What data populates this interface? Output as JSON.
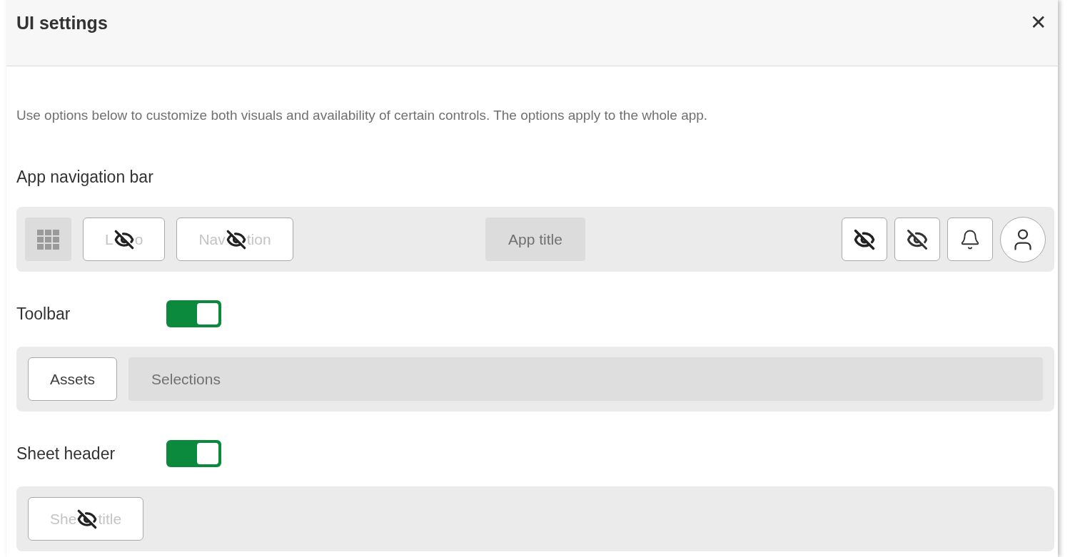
{
  "dialog": {
    "title": "UI settings",
    "close": "✕"
  },
  "description": "Use options below to customize both visuals and availability of certain controls. The options apply to the whole app.",
  "sections": [
    {
      "title": "App navigation bar",
      "items": [
        {
          "kind": "grid"
        },
        {
          "kind": "button",
          "parts": [
            "L",
            "o"
          ],
          "hidden": true
        },
        {
          "kind": "button",
          "parts": [
            "Nav",
            "tion"
          ],
          "hidden": true
        },
        {
          "kind": "title",
          "label": "App title"
        },
        {
          "kind": "eye",
          "hidden": true
        },
        {
          "kind": "eye",
          "hidden": true
        },
        {
          "kind": "bell"
        },
        {
          "kind": "avatar"
        }
      ]
    },
    {
      "title": "Toolbar",
      "toggle": {
        "on": true
      },
      "items": [
        {
          "kind": "button",
          "parts": [
            "Assets"
          ],
          "hidden": false
        },
        {
          "kind": "bar",
          "label": "Selections"
        }
      ]
    },
    {
      "title": "Sheet header",
      "toggle": {
        "on": true
      },
      "items": [
        {
          "kind": "button",
          "parts": [
            "She",
            "title"
          ],
          "hidden": true
        }
      ]
    }
  ]
}
